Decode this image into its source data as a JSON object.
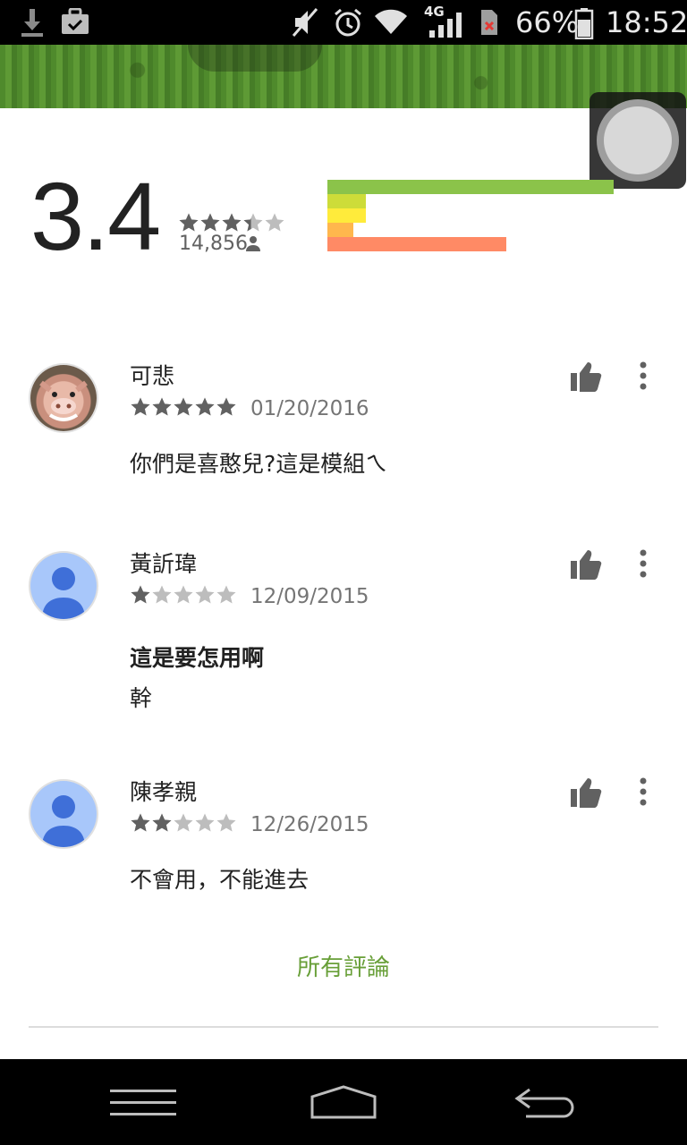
{
  "status_bar": {
    "network": "4G",
    "battery": "66%",
    "time": "18:52",
    "icons": [
      "download-icon",
      "briefcase-check-icon",
      "mute-icon",
      "alarm-icon",
      "wifi-icon",
      "signal-icon",
      "sim-error-icon",
      "battery-icon"
    ]
  },
  "rating_summary": {
    "average": "3.4",
    "average_stars": 3.4,
    "total_reviews": "14,856",
    "distribution": [
      {
        "stars": 5,
        "fraction": 1.0,
        "color": "#8bc34a"
      },
      {
        "stars": 4,
        "fraction": 0.135,
        "color": "#cddc39"
      },
      {
        "stars": 3,
        "fraction": 0.135,
        "color": "#ffeb3b"
      },
      {
        "stars": 2,
        "fraction": 0.09,
        "color": "#ffb74d"
      },
      {
        "stars": 1,
        "fraction": 0.625,
        "color": "#ff8a65"
      }
    ]
  },
  "reviews": [
    {
      "name": "可悲",
      "stars": 5,
      "date": "01/20/2016",
      "title": "",
      "body": "你們是喜憨兒?這是模組ㄟ",
      "avatar": "photo"
    },
    {
      "name": "黃訢瑋",
      "stars": 1,
      "date": "12/09/2015",
      "title": "這是要怎用啊",
      "body": "幹",
      "avatar": "default"
    },
    {
      "name": "陳孝親",
      "stars": 2,
      "date": "12/26/2015",
      "title": "",
      "body": "不會用，不能進去",
      "avatar": "default"
    }
  ],
  "all_reviews_label": "所有評論",
  "colors": {
    "accent_green": "#689f38",
    "star_filled": "#616161",
    "star_empty": "#bdbdbd"
  }
}
